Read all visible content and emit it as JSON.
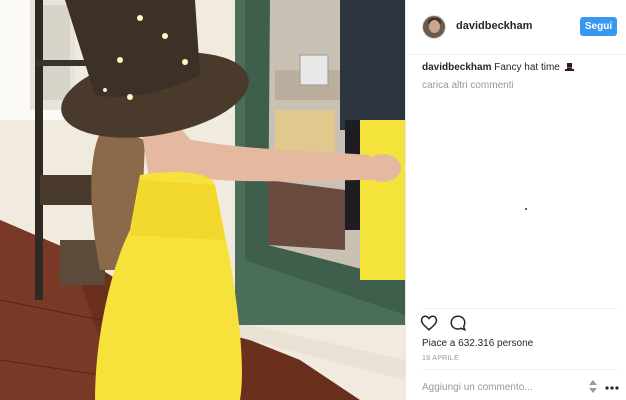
{
  "post": {
    "username": "davidbeckham",
    "follow_label": "Segui",
    "caption_user": "davidbeckham",
    "caption_text": "Fancy hat time",
    "more_comments": "carica altri commenti",
    "likes": "Piace a 632.316 persone",
    "date": "18 APRILE",
    "comment_placeholder": "Aggiungi un commento..."
  },
  "icons": {
    "like": "heart-icon",
    "comment": "comment-bubble-icon",
    "caption_emoji": "top-hat-emoji",
    "emoji_picker": "up-down-arrows-icon",
    "more": "more-options-icon"
  },
  "colors": {
    "follow_button": "#3897f0",
    "dress": "#f6e23a",
    "hat": "#4a3a2c"
  }
}
